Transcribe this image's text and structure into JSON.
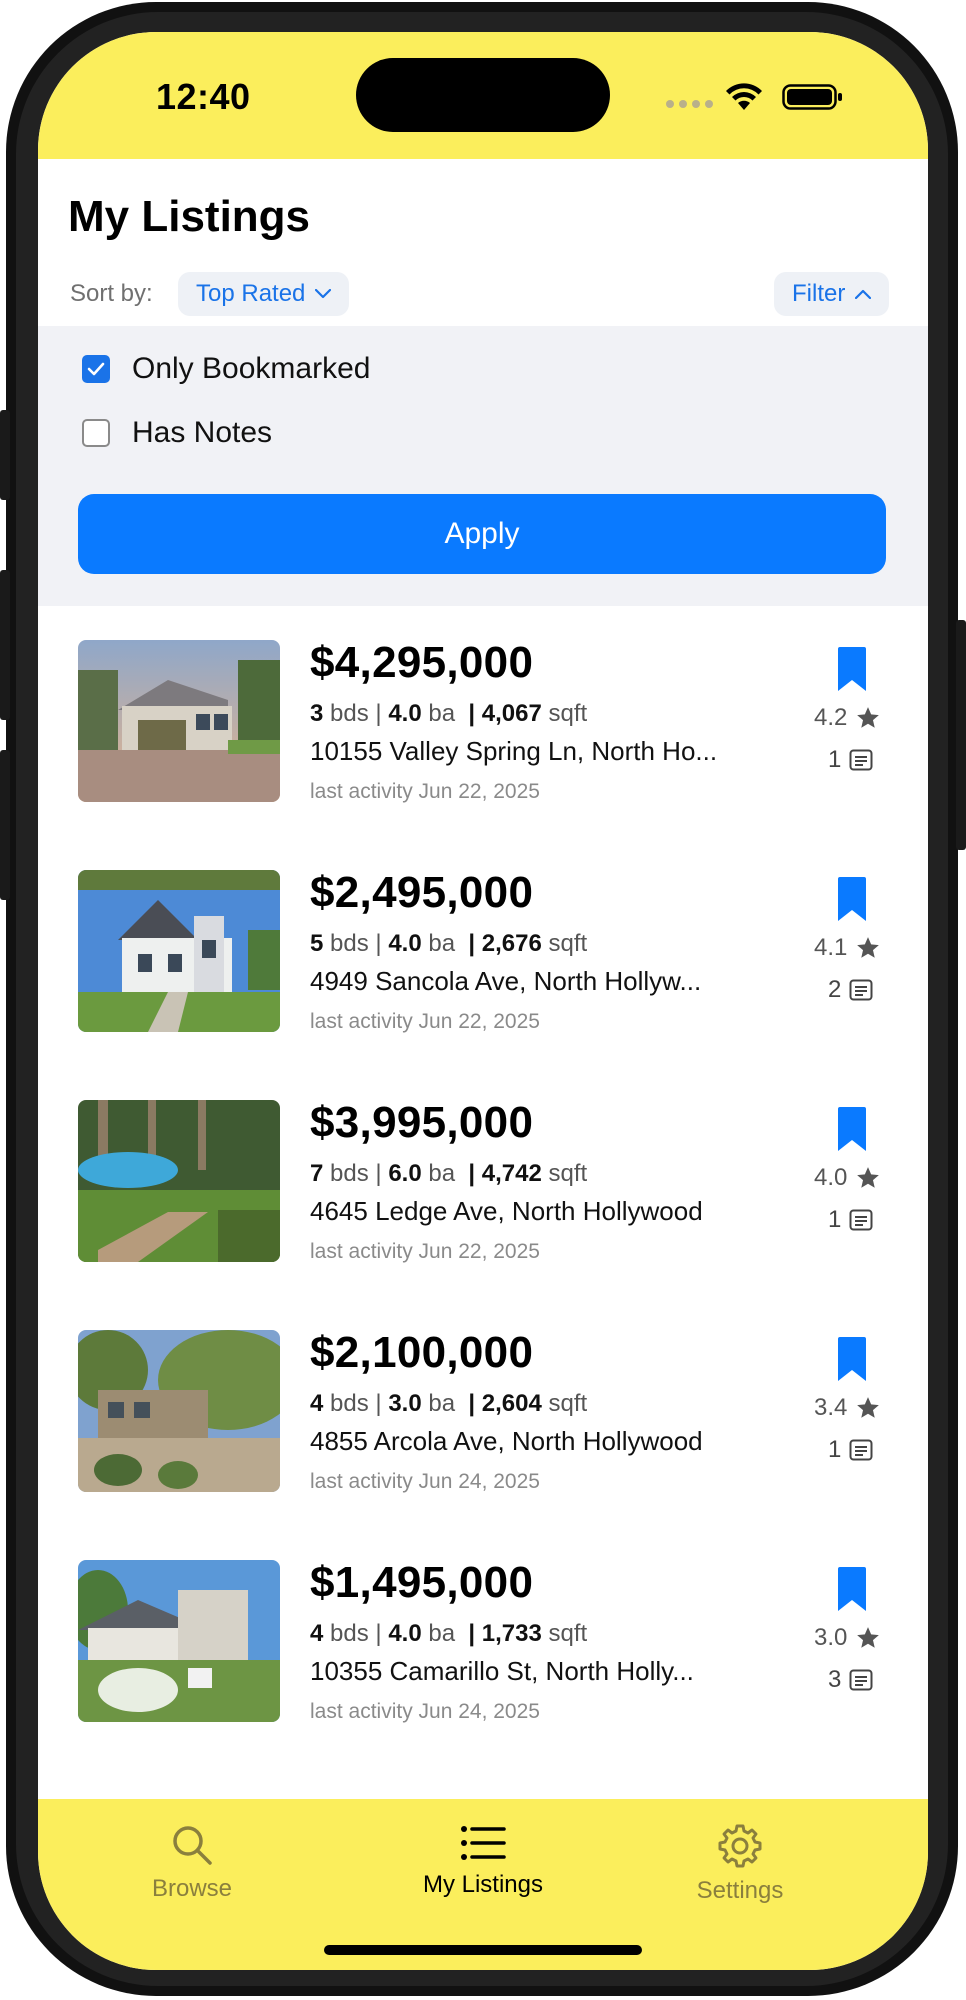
{
  "status": {
    "time": "12:40"
  },
  "header": {
    "title": "My Listings"
  },
  "sort": {
    "label": "Sort by:",
    "value": "Top Rated"
  },
  "filter": {
    "button_label": "Filter",
    "options": [
      {
        "label": "Only Bookmarked",
        "checked": true
      },
      {
        "label": "Has Notes",
        "checked": false
      }
    ],
    "apply_label": "Apply"
  },
  "listings": [
    {
      "price": "$4,295,000",
      "beds": "3",
      "beds_unit": "bds |",
      "baths": "4.0",
      "baths_unit": "ba",
      "sqft": "| 4,067",
      "sqft_unit": "sqft",
      "address": "10155 Valley Spring Ln, North Ho...",
      "activity": "last activity Jun 22, 2025",
      "rating": "4.2",
      "notes": "1",
      "bookmarked": true
    },
    {
      "price": "$2,495,000",
      "beds": "5",
      "beds_unit": "bds |",
      "baths": "4.0",
      "baths_unit": "ba",
      "sqft": "| 2,676",
      "sqft_unit": "sqft",
      "address": "4949 Sancola Ave, North Hollyw...",
      "activity": "last activity Jun 22, 2025",
      "rating": "4.1",
      "notes": "2",
      "bookmarked": true
    },
    {
      "price": "$3,995,000",
      "beds": "7",
      "beds_unit": "bds |",
      "baths": "6.0",
      "baths_unit": "ba",
      "sqft": "| 4,742",
      "sqft_unit": "sqft",
      "address": "4645 Ledge Ave, North Hollywood",
      "activity": "last activity Jun 22, 2025",
      "rating": "4.0",
      "notes": "1",
      "bookmarked": true
    },
    {
      "price": "$2,100,000",
      "beds": "4",
      "beds_unit": "bds |",
      "baths": "3.0",
      "baths_unit": "ba",
      "sqft": "| 2,604",
      "sqft_unit": "sqft",
      "address": "4855 Arcola Ave, North Hollywood",
      "activity": "last activity Jun 24, 2025",
      "rating": "3.4",
      "notes": "1",
      "bookmarked": true
    },
    {
      "price": "$1,495,000",
      "beds": "4",
      "beds_unit": "bds |",
      "baths": "4.0",
      "baths_unit": "ba",
      "sqft": "| 1,733",
      "sqft_unit": "sqft",
      "address": "10355 Camarillo St, North Holly...",
      "activity": "last activity Jun 24, 2025",
      "rating": "3.0",
      "notes": "3",
      "bookmarked": true
    }
  ],
  "tabs": [
    {
      "label": "Browse",
      "icon": "search-icon",
      "active": false
    },
    {
      "label": "My Listings",
      "icon": "list-icon",
      "active": true
    },
    {
      "label": "Settings",
      "icon": "gear-icon",
      "active": false
    }
  ],
  "colors": {
    "accent": "#0a7aff",
    "tabbar": "#fbee5c",
    "bookmark": "#0a7aff"
  }
}
